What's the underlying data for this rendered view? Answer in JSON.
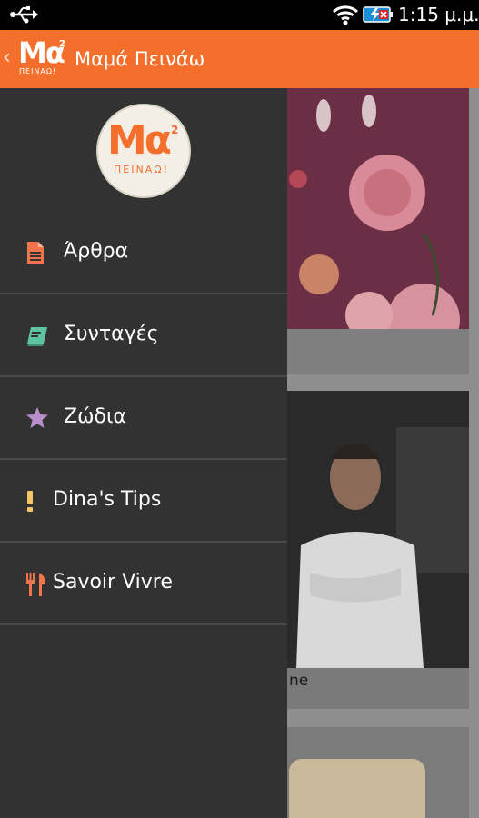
{
  "status_bar": {
    "time": "1:15 μ.μ.",
    "icons": [
      "usb-icon",
      "wifi-icon",
      "battery-charging-icon"
    ]
  },
  "action_bar": {
    "back_glyph": "‹",
    "logo": {
      "main": "Μα",
      "superscript": "2",
      "subtitle": "ΠΕΙΝΑΩ!"
    },
    "title": "Μαμά Πεινάω",
    "background": "#f36f2b"
  },
  "drawer": {
    "logo": {
      "main": "Μα",
      "superscript": "2",
      "subtitle": "ΠΕΙΝΑΩ!"
    },
    "background": "#323232",
    "items": [
      {
        "label": "Άρθρα",
        "icon": "document-icon",
        "icon_color": "#f0754a"
      },
      {
        "label": "Συνταγές",
        "icon": "book-icon",
        "icon_color": "#5cc4a0"
      },
      {
        "label": "Ζώδια",
        "icon": "star-icon",
        "icon_color": "#b68fc9"
      },
      {
        "label": "Dina's Tips",
        "icon": "exclamation-icon",
        "icon_color": "#f5c56a"
      },
      {
        "label": "Savoir Vivre",
        "icon": "fork-knife-icon",
        "icon_color": "#f0754a"
      }
    ]
  },
  "background_content": {
    "card2_caption": "ne"
  }
}
